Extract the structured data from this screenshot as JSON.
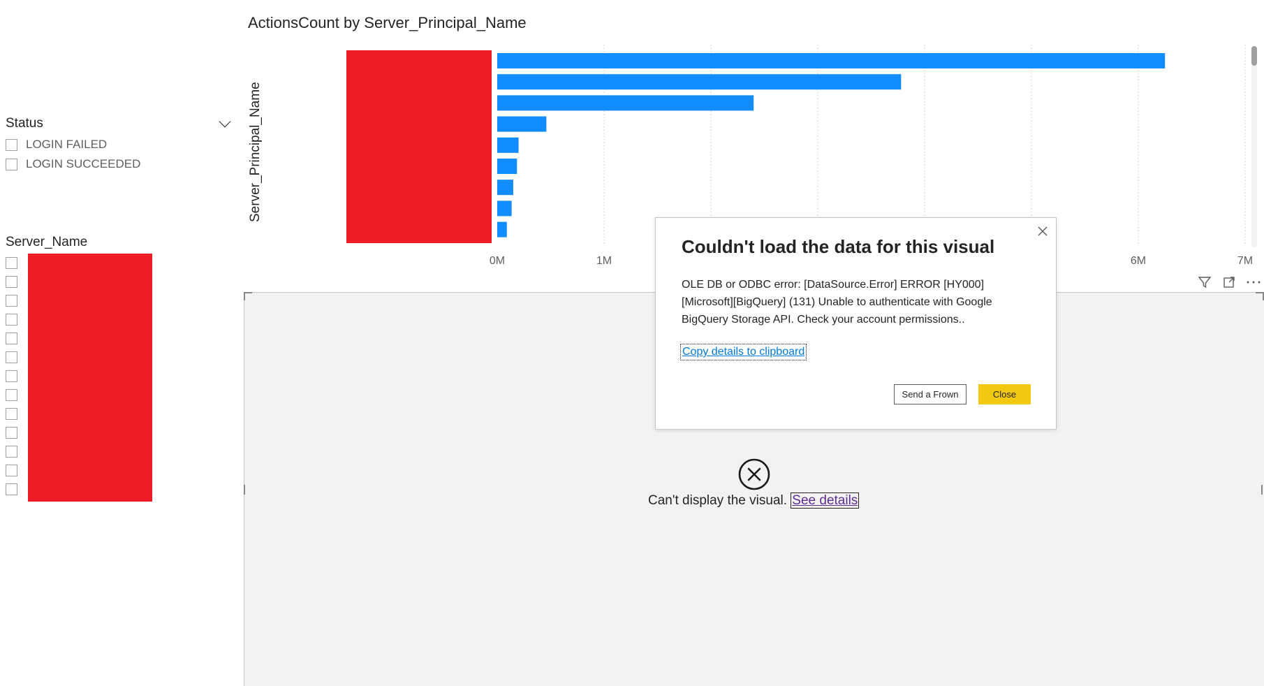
{
  "slicer_status": {
    "title": "Status",
    "items": [
      "LOGIN FAILED",
      "LOGIN SUCCEEDED"
    ]
  },
  "slicer_server_name": {
    "title": "Server_Name",
    "item_count": 13
  },
  "chart_data": {
    "type": "bar",
    "orientation": "horizontal",
    "title": "ActionsCount by Server_Principal_Name",
    "ylabel": "Server_Principal_Name",
    "xlabel": "",
    "xlim": [
      0,
      7000000
    ],
    "x_ticks": [
      "0M",
      "1M",
      "6M",
      "7M"
    ],
    "values": [
      6250000,
      3780000,
      2400000,
      460000,
      200000,
      185000,
      150000,
      135000,
      90000
    ],
    "bar_color": "#118dff",
    "grid": "vertical dotted"
  },
  "visual_header_icons": [
    "filter-icon",
    "focus-mode-icon",
    "more-options-icon"
  ],
  "lower_visual": {
    "message": "Can't display the visual.",
    "link": "See details"
  },
  "dialog": {
    "title": "Couldn't load the data for this visual",
    "message": "OLE DB or ODBC error: [DataSource.Error] ERROR [HY000] [Microsoft][BigQuery] (131) Unable to authenticate with Google BigQuery Storage API. Check your account permissions..",
    "copy_link": "Copy details to clipboard",
    "send_frown_label": "Send a Frown",
    "close_label": "Close"
  },
  "colors": {
    "accent": "#f2c811",
    "bar": "#118dff",
    "redaction": "#ee1c25"
  }
}
